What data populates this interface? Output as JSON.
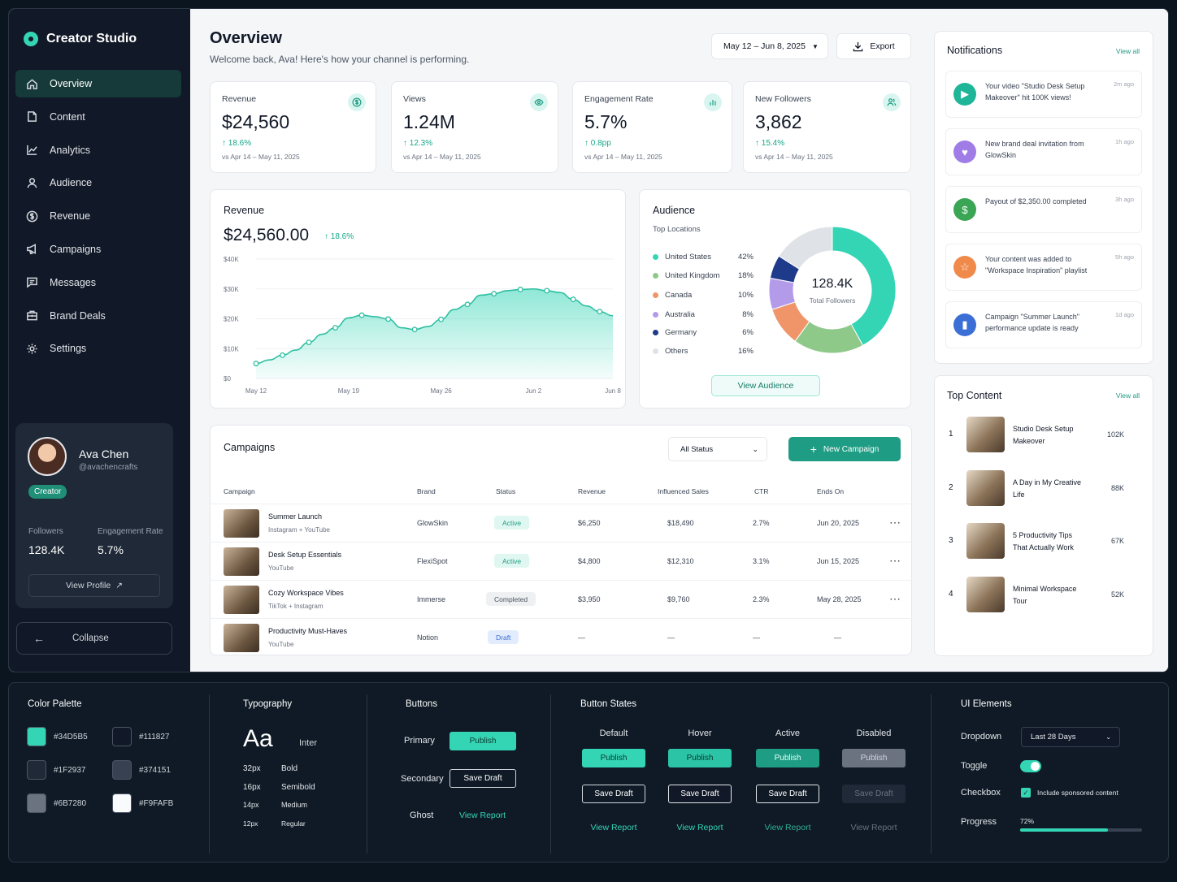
{
  "app": {
    "name": "Creator Studio"
  },
  "sidebar": {
    "items": [
      {
        "label": "Overview",
        "icon": "home-icon"
      },
      {
        "label": "Content",
        "icon": "file-icon"
      },
      {
        "label": "Analytics",
        "icon": "chart-icon"
      },
      {
        "label": "Audience",
        "icon": "user-icon"
      },
      {
        "label": "Revenue",
        "icon": "dollar-icon"
      },
      {
        "label": "Campaigns",
        "icon": "megaphone-icon"
      },
      {
        "label": "Messages",
        "icon": "message-icon"
      },
      {
        "label": "Brand Deals",
        "icon": "briefcase-icon"
      },
      {
        "label": "Settings",
        "icon": "gear-icon"
      }
    ]
  },
  "profile": {
    "name": "Ava Chen",
    "handle": "@avachencrafts",
    "tag": "Creator",
    "followers_label": "Followers",
    "followers": "128.4K",
    "engagement_label": "Engagement Rate",
    "engagement": "5.7%",
    "view_profile": "View Profile"
  },
  "collapse": "Collapse",
  "header": {
    "title": "Overview",
    "subtitle": "Welcome back, Ava! Here's how your channel is performing.",
    "date_range": "May 12 – Jun 8, 2025",
    "export": "Export"
  },
  "kpis": [
    {
      "label": "Revenue",
      "value": "$24,560",
      "delta": "18.6%",
      "compare": "vs Apr 14 – May 11, 2025",
      "icon": "dollar-icon"
    },
    {
      "label": "Views",
      "value": "1.24M",
      "delta": "12.3%",
      "compare": "vs Apr 14 – May 11, 2025",
      "icon": "eye-icon"
    },
    {
      "label": "Engagement Rate",
      "value": "5.7%",
      "delta": "0.8pp",
      "compare": "vs Apr 14 – May 11, 2025",
      "icon": "bar-chart-icon"
    },
    {
      "label": "New Followers",
      "value": "3,862",
      "delta": "15.4%",
      "compare": "vs Apr 14 – May 11, 2025",
      "icon": "users-icon"
    }
  ],
  "revenue_chart": {
    "title": "Revenue",
    "total": "$24,560.00",
    "delta": "18.6%"
  },
  "chart_data": {
    "type": "area",
    "x": [
      "May 12",
      "May 13",
      "May 14",
      "May 15",
      "May 16",
      "May 17",
      "May 18",
      "May 19",
      "May 20",
      "May 21",
      "May 22",
      "May 23",
      "May 24",
      "May 25",
      "May 26",
      "May 27",
      "May 28",
      "May 29",
      "May 30",
      "May 31",
      "Jun 1",
      "Jun 2",
      "Jun 3",
      "Jun 4",
      "Jun 5",
      "Jun 6",
      "Jun 7",
      "Jun 8"
    ],
    "y": [
      5000,
      6200,
      7800,
      9500,
      12100,
      14800,
      17000,
      20300,
      21200,
      20700,
      19900,
      17000,
      16400,
      17400,
      19800,
      23100,
      24800,
      27900,
      28400,
      29400,
      29800,
      30000,
      29400,
      28800,
      26500,
      24300,
      22400,
      21000
    ],
    "marker_every": 2,
    "ylim": [
      0,
      40000
    ],
    "yticks": [
      "$0",
      "$10K",
      "$20K",
      "$30K",
      "$40K"
    ],
    "xticks": [
      "May 12",
      "May 19",
      "May 26",
      "Jun 2",
      "Jun 8"
    ],
    "grid": true
  },
  "audience": {
    "title": "Audience",
    "subtitle": "Top Locations",
    "total": "128.4K",
    "total_label": "Total Followers",
    "button": "View Audience",
    "locations": [
      {
        "name": "United States",
        "pct": "42%",
        "value": 42,
        "color": "#34d5b5"
      },
      {
        "name": "United Kingdom",
        "pct": "18%",
        "value": 18,
        "color": "#8fc98a"
      },
      {
        "name": "Canada",
        "pct": "10%",
        "value": 10,
        "color": "#f0956a"
      },
      {
        "name": "Australia",
        "pct": "8%",
        "value": 8,
        "color": "#b49bea"
      },
      {
        "name": "Germany",
        "pct": "6%",
        "value": 6,
        "color": "#1e3a8a"
      },
      {
        "name": "Others",
        "pct": "16%",
        "value": 16,
        "color": "#dfe3e8"
      }
    ]
  },
  "campaigns": {
    "title": "Campaigns",
    "filter": "All Status",
    "new_button": "New Campaign",
    "columns": [
      "Campaign",
      "Brand",
      "Status",
      "Revenue",
      "Influenced Sales",
      "CTR",
      "Ends On"
    ],
    "rows": [
      {
        "name": "Summer Launch",
        "sub": "Instagram + YouTube",
        "brand": "GlowSkin",
        "status": "Active",
        "revenue": "$6,250",
        "sales": "$18,490",
        "ctr": "2.7%",
        "ends": "Jun 20, 2025",
        "menu": "⋯"
      },
      {
        "name": "Desk Setup Essentials",
        "sub": "YouTube",
        "brand": "FlexiSpot",
        "status": "Active",
        "revenue": "$4,800",
        "sales": "$12,310",
        "ctr": "3.1%",
        "ends": "Jun 15, 2025",
        "menu": "⋯"
      },
      {
        "name": "Cozy Workspace Vibes",
        "sub": "TikTok + Instagram",
        "brand": "Immerse",
        "status": "Completed",
        "revenue": "$3,950",
        "sales": "$9,760",
        "ctr": "2.3%",
        "ends": "May 28, 2025",
        "menu": "⋯"
      },
      {
        "name": "Productivity Must-Haves",
        "sub": "YouTube",
        "brand": "Notion",
        "status": "Draft",
        "revenue": "—",
        "sales": "—",
        "ctr": "—",
        "ends": "—",
        "menu": ""
      }
    ]
  },
  "notifications": {
    "title": "Notifications",
    "view_all": "View all",
    "items": [
      {
        "text": "Your video \"Studio Desk Setup Makeover\" hit 100K views!",
        "time": "2m ago",
        "color": "#1fb598",
        "icon": "play-icon"
      },
      {
        "text": "New brand deal invitation from GlowSkin",
        "time": "1h ago",
        "color": "#a07ce6",
        "icon": "handshake-icon"
      },
      {
        "text": "Payout of $2,350.00 completed",
        "time": "3h ago",
        "color": "#3aa655",
        "icon": "dollar-icon"
      },
      {
        "text": "Your content was added to \"Workspace Inspiration\" playlist",
        "time": "5h ago",
        "color": "#f08a4b",
        "icon": "star-icon"
      },
      {
        "text": "Campaign \"Summer Launch\" performance update is ready",
        "time": "1d ago",
        "color": "#3b6fd6",
        "icon": "bar-chart-icon"
      }
    ]
  },
  "top_content": {
    "title": "Top Content",
    "view_all": "View all",
    "items": [
      {
        "rank": "1",
        "name": "Studio Desk Setup Makeover",
        "views": "102K"
      },
      {
        "rank": "2",
        "name": "A Day in My Creative Life",
        "views": "88K"
      },
      {
        "rank": "3",
        "name": "5 Productivity Tips That Actually Work",
        "views": "67K"
      },
      {
        "rank": "4",
        "name": "Minimal Workspace Tour",
        "views": "52K"
      }
    ]
  },
  "palette": {
    "title": "Color Palette",
    "colors": [
      {
        "hex": "#34D5B5"
      },
      {
        "hex": "#111827"
      },
      {
        "hex": "#1F2937"
      },
      {
        "hex": "#374151"
      },
      {
        "hex": "#6B7280"
      },
      {
        "hex": "#F9FAFB"
      }
    ]
  },
  "typography": {
    "title": "Typography",
    "sample": "Aa",
    "font": "Inter",
    "sizes": [
      {
        "size": "32px",
        "weight": "Bold"
      },
      {
        "size": "16px",
        "weight": "Semibold"
      },
      {
        "size": "14px",
        "weight": "Medium"
      },
      {
        "size": "12px",
        "weight": "Regular"
      }
    ]
  },
  "buttons": {
    "title": "Buttons",
    "primary_label": "Primary",
    "primary": "Publish",
    "secondary_label": "Secondary",
    "secondary": "Save Draft",
    "ghost_label": "Ghost",
    "ghost": "View Report"
  },
  "button_states": {
    "title": "Button States",
    "states": [
      "Default",
      "Hover",
      "Active",
      "Disabled"
    ],
    "publish": "Publish",
    "save": "Save Draft",
    "view": "View Report"
  },
  "ui_elements": {
    "title": "UI Elements",
    "dropdown_label": "Dropdown",
    "dropdown_value": "Last 28 Days",
    "toggle_label": "Toggle",
    "toggle_on": true,
    "checkbox_label": "Checkbox",
    "checkbox_text": "Include sponsored content",
    "checkbox_checked": true,
    "progress_label": "Progress",
    "progress_text": "72%",
    "progress": 0.72
  }
}
